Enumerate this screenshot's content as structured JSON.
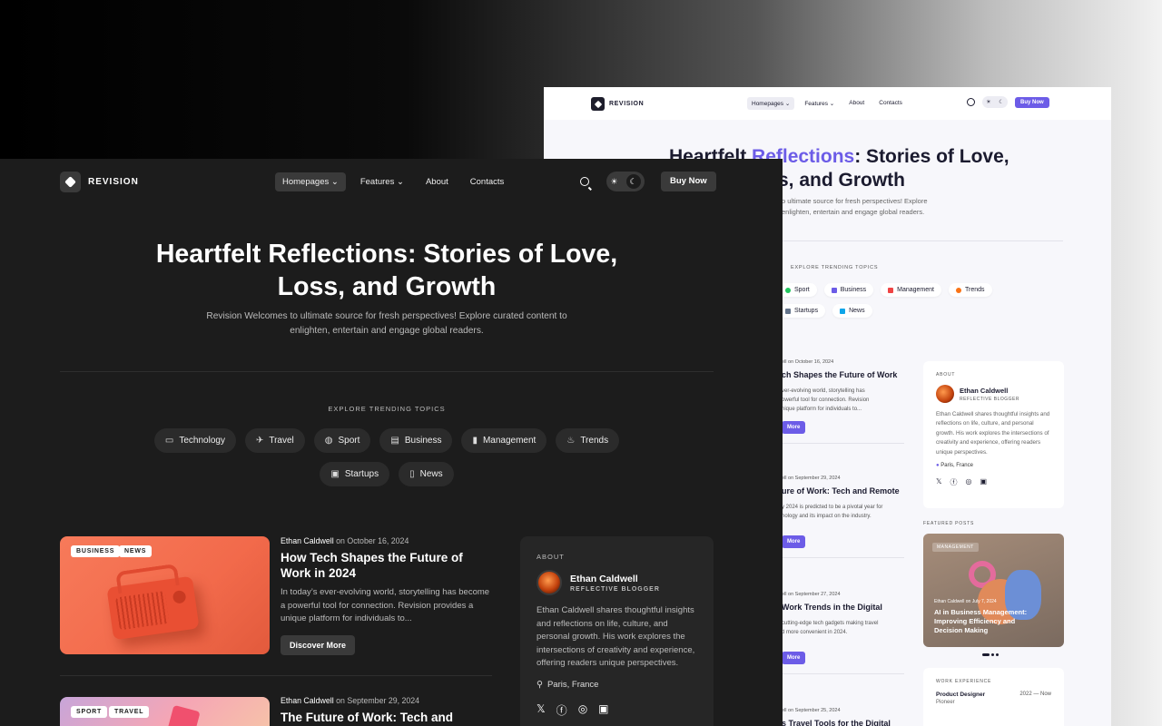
{
  "light": {
    "brand": "REVISION",
    "menu": [
      "Homepages",
      "Features",
      "About",
      "Contacts"
    ],
    "buy_label": "Buy Now",
    "title_pre": "Heartfelt ",
    "title_accent": "Reflections",
    "title_post": ": Stories of Love,",
    "title_line2": "s, and Growth",
    "subtitle_1": "o ultimate source for fresh perspectives! Explore",
    "subtitle_2": "enlighten, entertain and engage global readers.",
    "topics_heading": "EXPLORE TRENDING TOPICS",
    "topics": [
      {
        "label": "Sport",
        "color": "#22c55e"
      },
      {
        "label": "Business",
        "color": "#6c5ce7"
      },
      {
        "label": "Management",
        "color": "#ef4444"
      },
      {
        "label": "Trends",
        "color": "#f97316"
      },
      {
        "label": "Startups",
        "color": "#64748b"
      },
      {
        "label": "News",
        "color": "#0ea5e9"
      }
    ],
    "posts": [
      {
        "meta": "ell on October 16, 2024",
        "title": "ch Shapes the Future of Work",
        "desc_1": "ver-evolving world, storytelling has",
        "desc_2": "owerful tool for connection. Revision",
        "desc_3": "nique platform for individuals to...",
        "btn": "More"
      },
      {
        "meta": "ell on September 29, 2024",
        "title": "ure of Work: Tech and Remote",
        "desc_1": "y 2024 is predicted to be a pivotal year for",
        "desc_2": "nology and its impact on the industry.",
        "desc_3": "",
        "btn": "More"
      },
      {
        "meta": "ell on September 27, 2024",
        "title": "Work Trends in the Digital",
        "desc_1": "cutting-edge tech gadgets making travel",
        "desc_2": "d more convenient in 2024.",
        "desc_3": "",
        "btn": "More"
      },
      {
        "meta": "ell on September 25, 2024",
        "title": "s Travel Tools for the Digital",
        "desc_1": "",
        "desc_2": "",
        "desc_3": "",
        "btn": ""
      }
    ],
    "about": {
      "label": "ABOUT",
      "name": "Ethan Caldwell",
      "role": "REFLECTIVE BLOGGER",
      "bio": "Ethan Caldwell shares thoughtful insights and reflections on life, culture, and personal growth. His work explores the intersections of creativity and experience, offering readers unique perspectives.",
      "location": "Paris, France"
    },
    "featured": {
      "heading": "FEATURED POSTS",
      "tag": "MANAGEMENT",
      "meta": "Ethan Caldwell  on July 7, 2024",
      "title": "AI in Business Management: Improving Efficiency and Decision Making"
    },
    "work": {
      "heading": "WORK EXPERIENCE",
      "role": "Product Designer",
      "years": "2022 — Now",
      "company": "Pioneer"
    }
  },
  "dark": {
    "brand": "REVISION",
    "menu": [
      "Homepages",
      "Features",
      "About",
      "Contacts"
    ],
    "buy_label": "Buy Now",
    "title": "Heartfelt Reflections: Stories of Love, Loss, and Growth",
    "subtitle": "Revision Welcomes to ultimate source for fresh perspectives! Explore curated content to enlighten, entertain and engage global readers.",
    "topics_heading": "EXPLORE TRENDING TOPICS",
    "topics": [
      {
        "label": "Technology",
        "icon": "laptop-icon",
        "glyph": "▭"
      },
      {
        "label": "Travel",
        "icon": "plane-icon",
        "glyph": "✈"
      },
      {
        "label": "Sport",
        "icon": "ball-icon",
        "glyph": "◍"
      },
      {
        "label": "Business",
        "icon": "briefcase-icon",
        "glyph": "▤"
      },
      {
        "label": "Management",
        "icon": "chart-icon",
        "glyph": "▮"
      },
      {
        "label": "Trends",
        "icon": "fire-icon",
        "glyph": "♨"
      },
      {
        "label": "Startups",
        "icon": "presentation-icon",
        "glyph": "▣"
      },
      {
        "label": "News",
        "icon": "document-icon",
        "glyph": "▯"
      }
    ],
    "posts": [
      {
        "tags": [
          "BUSINESS",
          "NEWS"
        ],
        "author": "Ethan Caldwell",
        "date": " on October 16, 2024",
        "title": "How Tech Shapes the Future of Work in 2024",
        "desc": "In today’s ever-evolving world, storytelling has become a powerful tool for connection. Revision provides a unique platform for individuals to...",
        "btn": "Discover More"
      },
      {
        "tags": [
          "SPORT",
          "TRAVEL"
        ],
        "author": "Ethan Caldwell",
        "date": " on September 29, 2024",
        "title": "The Future of Work: Tech and Remote"
      }
    ],
    "about": {
      "label": "ABOUT",
      "name": "Ethan Caldwell",
      "role": "REFLECTIVE BLOGGER",
      "bio": "Ethan Caldwell shares thoughtful insights and reflections on life, culture, and personal growth. His work explores the intersections of creativity and experience, offering readers unique perspectives.",
      "location": "Paris, France"
    },
    "socials": [
      "x-icon",
      "facebook-icon",
      "instagram-icon",
      "linkedin-icon"
    ]
  }
}
